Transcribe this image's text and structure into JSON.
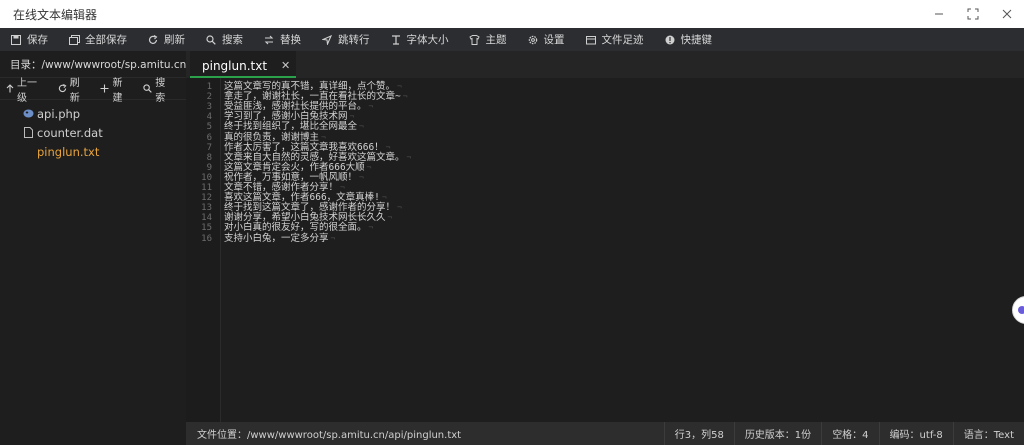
{
  "window": {
    "title": "在线文本编辑器",
    "controls": [
      {
        "name": "minimize-icon"
      },
      {
        "name": "maximize-icon"
      },
      {
        "name": "close-icon"
      }
    ]
  },
  "toolbar": {
    "items": [
      {
        "label": "保存",
        "icon": "save-icon"
      },
      {
        "label": "全部保存",
        "icon": "save-all-icon"
      },
      {
        "label": "刷新",
        "icon": "refresh-icon"
      },
      {
        "label": "搜索",
        "icon": "search-icon"
      },
      {
        "label": "替换",
        "icon": "replace-icon"
      },
      {
        "label": "跳转行",
        "icon": "goto-line-icon"
      },
      {
        "label": "字体大小",
        "icon": "font-size-icon"
      },
      {
        "label": "主题",
        "icon": "theme-icon"
      },
      {
        "label": "设置",
        "icon": "settings-icon"
      },
      {
        "label": "文件足迹",
        "icon": "history-icon"
      },
      {
        "label": "快捷键",
        "icon": "keyboard-icon"
      }
    ]
  },
  "sidebar": {
    "directory": "目录：/www/wwwroot/sp.amitu.cn...",
    "actions": [
      {
        "label": "上一级",
        "icon": "arrow-up-icon"
      },
      {
        "label": "刷新",
        "icon": "refresh-icon"
      },
      {
        "label": "新建",
        "icon": "plus-icon"
      },
      {
        "label": "搜索",
        "icon": "search-icon"
      }
    ],
    "files": [
      {
        "name": "api.php",
        "icon": "php-file-icon",
        "active": false
      },
      {
        "name": "counter.dat",
        "icon": "file-icon",
        "active": false
      },
      {
        "name": "pinglun.txt",
        "icon": "text-file-icon",
        "active": true
      }
    ]
  },
  "editor": {
    "tab": {
      "label": "pinglun.txt",
      "close": "✕"
    },
    "lines": [
      "这篇文章写的真不错，真详细，点个赞。",
      "拿走了，谢谢社长，一直在看社长的文章~",
      "受益匪浅，感谢社长提供的平台。",
      "学习到了，感谢小白兔技术网",
      "终于找到组织了，堪比全网最全",
      "真的很负责，谢谢博主",
      "作者太厉害了，这篇文章我喜欢666！",
      "文章来自大自然的灵感，好喜欢这篇文章。",
      "这篇文章肯定会火，作者666大顺",
      "祝作者，万事如意，一帆风顺！",
      "文章不错，感谢作者分享！",
      "喜欢这篇文章，作者666，文章真棒!",
      "终于找到这篇文章了，感谢作者的分享！",
      "谢谢分享，希望小白兔技术网长长久久",
      "对小白真的很友好，写的很全面。",
      "支持小白兔，一定多分享"
    ],
    "eol_marker": "¬"
  },
  "status": {
    "path": "文件位置：/www/wwwroot/sp.amitu.cn/api/pinglun.txt",
    "position": "行3，列58",
    "history": "历史版本：1份",
    "indent": "空格：4",
    "encoding": "编码：utf-8",
    "language": "语言：Text"
  },
  "colors": {
    "active_file": "#e8a33d",
    "tab_accent": "#2aa14a",
    "toolbar_bg": "#2b2d30",
    "editor_bg": "#1e1e1e"
  }
}
